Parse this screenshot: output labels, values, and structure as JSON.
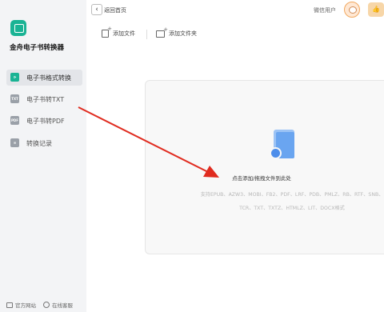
{
  "app": {
    "name": "金舟电子书转换器"
  },
  "sidebar": {
    "items": [
      {
        "label": "电子书格式转换",
        "icon": "convert-icon",
        "active": true
      },
      {
        "label": "电子书转TXT",
        "icon": "txt-icon",
        "active": false
      },
      {
        "label": "电子书转PDF",
        "icon": "pdf-icon",
        "active": false
      },
      {
        "label": "转换记录",
        "icon": "history-icon",
        "active": false
      }
    ],
    "footer": {
      "website_label": "官方网站",
      "support_label": "在线客服"
    }
  },
  "topbar": {
    "back_label": "返回首页",
    "user_label": "微信用户"
  },
  "toolbar": {
    "add_file_label": "添加文件",
    "add_folder_label": "添加文件夹"
  },
  "dropzone": {
    "hint": "点击添加/拖拽文件到此处",
    "formats_line1": "支持EPUB、AZW3、MOBI、FB2、PDF、LRF、PDB、PMLZ、RB、RTF、SNB、",
    "formats_line2": "TCR、TXT、TXTZ、HTMLZ、LIT、DOCX格式"
  },
  "colors": {
    "brand": "#19b394",
    "arrow": "#e02b1f",
    "doc_icon": "#6aa5f0"
  }
}
